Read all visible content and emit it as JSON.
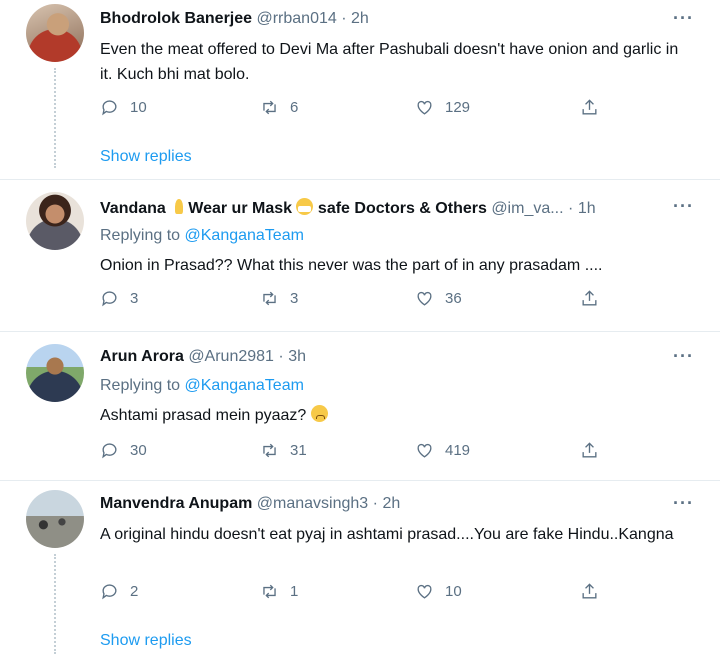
{
  "tweets": [
    {
      "name": "Bhodrolok Banerjee",
      "handle": "@rrban014",
      "time": "2h",
      "separator": "·",
      "more": "···",
      "text": "Even the meat offered to Devi Ma after Pashubali doesn't have onion and garlic in it. Kuch bhi mat bolo.",
      "replies": "10",
      "retweets": "6",
      "likes": "129",
      "show_replies": "Show replies"
    },
    {
      "name_part1": "Vandana",
      "name_part2": "Wear ur Mask",
      "name_part3": "safe Doctors & Others",
      "handle": "@im_va...",
      "time": "1h",
      "separator": "·",
      "more": "···",
      "replying_prefix": "Replying to",
      "replying_to": "@KanganaTeam",
      "text": "Onion in Prasad?? What this never was the part of in any prasadam ....",
      "replies": "3",
      "retweets": "3",
      "likes": "36"
    },
    {
      "name": "Arun Arora",
      "handle": "@Arun2981",
      "time": "3h",
      "separator": "·",
      "more": "···",
      "replying_prefix": "Replying to",
      "replying_to": "@KanganaTeam",
      "text": "Ashtami prasad mein pyaaz?",
      "replies": "30",
      "retweets": "31",
      "likes": "419"
    },
    {
      "name": "Manvendra Anupam",
      "handle": "@manavsingh3",
      "time": "2h",
      "separator": "·",
      "more": "···",
      "text": "A original hindu doesn't eat pyaj in ashtami prasad....You are fake Hindu..Kangna",
      "replies": "2",
      "retweets": "1",
      "likes": "10",
      "show_replies": "Show replies"
    }
  ],
  "icons": {
    "reply": "reply-icon",
    "retweet": "retweet-icon",
    "like": "heart-icon",
    "share": "share-icon",
    "more": "more-icon"
  },
  "colors": {
    "link": "#1d9bf0",
    "muted": "#5b7083",
    "text": "#0f1419",
    "divider": "#e6ecf0"
  }
}
